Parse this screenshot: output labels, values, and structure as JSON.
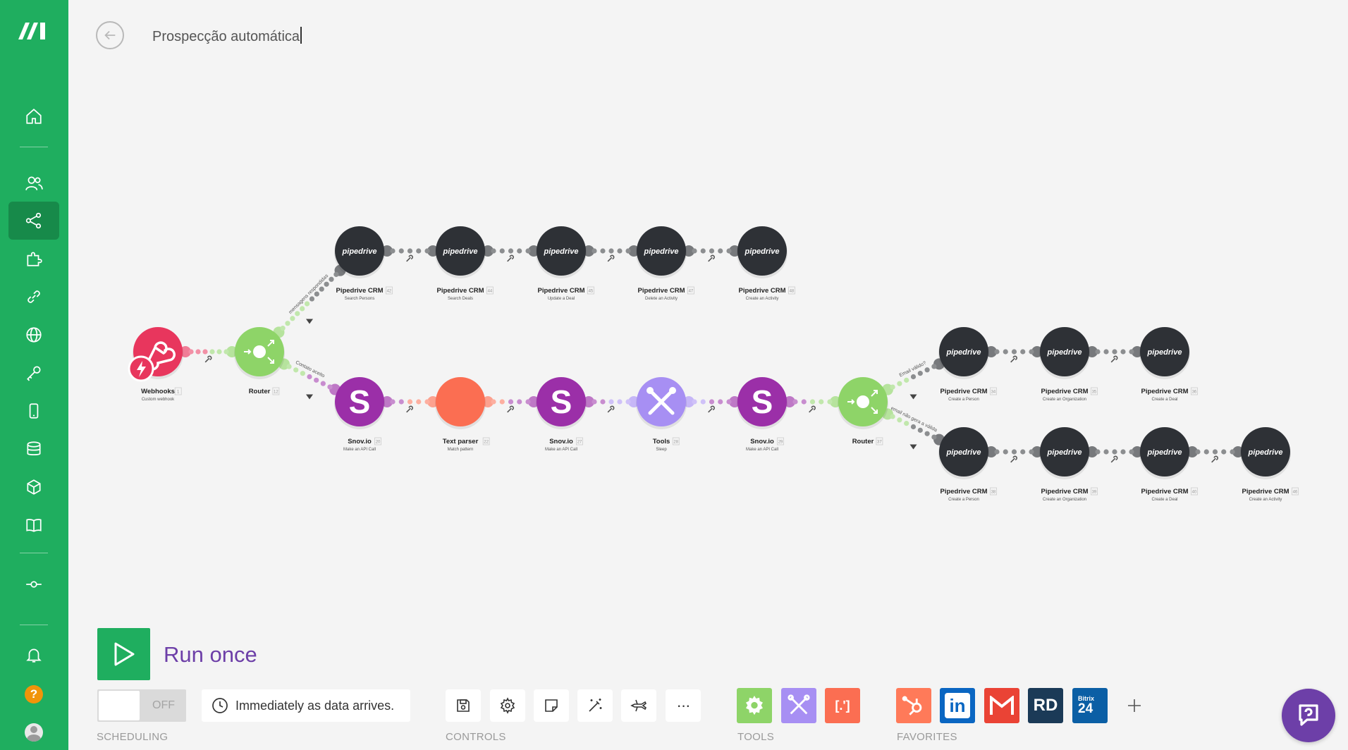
{
  "app": {
    "scenario_name": "Prospecção automática",
    "brand_color": "#1fae5f",
    "accent_color": "#6d3fa8"
  },
  "sidebar": {
    "items": [
      {
        "icon": "home-icon"
      },
      {
        "icon": "team-icon"
      },
      {
        "icon": "scenarios-icon",
        "active": true
      },
      {
        "icon": "apps-puzzle-icon"
      },
      {
        "icon": "connections-link-icon"
      },
      {
        "icon": "webhooks-globe-icon"
      },
      {
        "icon": "keys-icon"
      },
      {
        "icon": "devices-icon"
      },
      {
        "icon": "data-stores-icon"
      },
      {
        "icon": "data-structures-icon"
      },
      {
        "icon": "templates-book-icon"
      },
      {
        "icon": "commit-icon"
      },
      {
        "icon": "notifications-bell-icon"
      },
      {
        "icon": "help-icon",
        "text": "?"
      },
      {
        "icon": "user-avatar-icon"
      }
    ]
  },
  "scenario": {
    "route_labels": {
      "top": "mensagens respondidas",
      "middle": "Contato aceito",
      "router2_top": "Email válido?",
      "router2_bottom": "email não gera a válida"
    },
    "modules": [
      {
        "id": "webhooks",
        "name": "Webhooks",
        "action": "Custom webhook",
        "num": "1",
        "color": "#e8365d",
        "icon": "webhook-icon"
      },
      {
        "id": "router1",
        "name": "Router",
        "action": "",
        "num": "12",
        "color": "#8ed468",
        "icon": "router-icon"
      },
      {
        "id": "pd42",
        "name": "Pipedrive CRM",
        "action": "Search Persons",
        "num": "42",
        "color": "#2e3136",
        "logo": "pipedrive"
      },
      {
        "id": "pd44",
        "name": "Pipedrive CRM",
        "action": "Search Deals",
        "num": "44",
        "color": "#2e3136",
        "logo": "pipedrive"
      },
      {
        "id": "pd45",
        "name": "Pipedrive CRM",
        "action": "Update a Deal",
        "num": "45",
        "color": "#2e3136",
        "logo": "pipedrive"
      },
      {
        "id": "pd47",
        "name": "Pipedrive CRM",
        "action": "Delete an Activity",
        "num": "47",
        "color": "#2e3136",
        "logo": "pipedrive"
      },
      {
        "id": "pd48",
        "name": "Pipedrive CRM",
        "action": "Create an Activity",
        "num": "48",
        "color": "#2e3136",
        "logo": "pipedrive"
      },
      {
        "id": "snov1",
        "name": "Snov.io",
        "action": "Make an API Call",
        "num": "20",
        "color": "#9b2fa8",
        "logo": "S"
      },
      {
        "id": "parser",
        "name": "Text parser",
        "action": "Match pattern",
        "num": "22",
        "color": "#fb6e52",
        "logo": ""
      },
      {
        "id": "snov2",
        "name": "Snov.io",
        "action": "Make an API Call",
        "num": "27",
        "color": "#9b2fa8",
        "logo": "S"
      },
      {
        "id": "tools",
        "name": "Tools",
        "action": "Sleep",
        "num": "28",
        "color": "#a78ff3",
        "icon": "tools-icon"
      },
      {
        "id": "snov3",
        "name": "Snov.io",
        "action": "Make an API Call",
        "num": "29",
        "color": "#9b2fa8",
        "logo": "S"
      },
      {
        "id": "router2",
        "name": "Router",
        "action": "",
        "num": "37",
        "color": "#8ed468",
        "icon": "router-icon"
      },
      {
        "id": "pd34",
        "name": "Pipedrive CRM",
        "action": "Create a Person",
        "num": "34",
        "color": "#2e3136",
        "logo": "pipedrive"
      },
      {
        "id": "pd35",
        "name": "Pipedrive CRM",
        "action": "Create an Organization",
        "num": "35",
        "color": "#2e3136",
        "logo": "pipedrive"
      },
      {
        "id": "pd36",
        "name": "Pipedrive CRM",
        "action": "Create a Deal",
        "num": "36",
        "color": "#2e3136",
        "logo": "pipedrive"
      },
      {
        "id": "pd38",
        "name": "Pipedrive CRM",
        "action": "Create a Person",
        "num": "38",
        "color": "#2e3136",
        "logo": "pipedrive"
      },
      {
        "id": "pd39",
        "name": "Pipedrive CRM",
        "action": "Create an Organization",
        "num": "39",
        "color": "#2e3136",
        "logo": "pipedrive"
      },
      {
        "id": "pd40",
        "name": "Pipedrive CRM",
        "action": "Create a Deal",
        "num": "40",
        "color": "#2e3136",
        "logo": "pipedrive"
      },
      {
        "id": "pd46",
        "name": "Pipedrive CRM",
        "action": "Create an Activity",
        "num": "46",
        "color": "#2e3136",
        "logo": "pipedrive"
      }
    ]
  },
  "toolbar": {
    "run_once_label": "Run once",
    "scheduling": {
      "toggle_state": "OFF",
      "schedule_text": "Immediately as data arrives.",
      "group_label": "SCHEDULING"
    },
    "controls": {
      "group_label": "CONTROLS",
      "items": [
        "save-icon",
        "settings-gear-icon",
        "notes-icon",
        "auto-align-wand-icon",
        "explain-flow-plane-icon",
        "more-dots-icon"
      ],
      "more_text": "···"
    },
    "tools": {
      "group_label": "TOOLS",
      "items": [
        {
          "icon": "flow-control-gear-icon",
          "color": "#8ed468"
        },
        {
          "icon": "tools-icon",
          "color": "#a78ff3"
        },
        {
          "icon": "text-parser-icon",
          "color": "#fb6e52",
          "text": "[.']"
        }
      ]
    },
    "favorites": {
      "group_label": "FAVORITES",
      "items": [
        {
          "icon": "hubspot-icon",
          "color": "#ff7a59"
        },
        {
          "icon": "linkedin-icon",
          "color": "#0a66c2",
          "text": "in"
        },
        {
          "icon": "gmail-icon",
          "color": "#ea4335"
        },
        {
          "icon": "rd-station-icon",
          "color": "#1b3a57",
          "text": "RD"
        },
        {
          "icon": "bitrix24-icon",
          "color": "#0b5fa5",
          "text": "Bitrix",
          "sub": "24"
        }
      ],
      "add_icon": "plus-icon"
    }
  }
}
